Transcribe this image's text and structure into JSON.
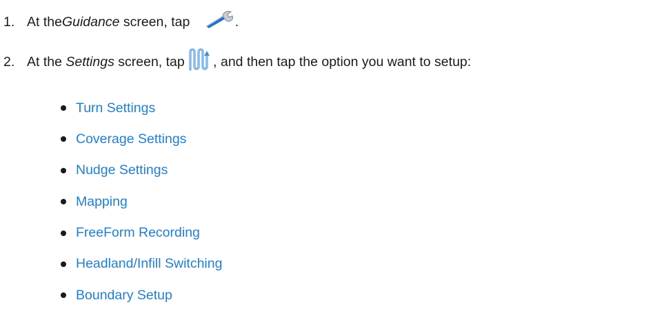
{
  "steps": [
    {
      "number": "1.",
      "text_before": "At the ",
      "emphasis": "Guidance",
      "text_middle": " screen, tap ",
      "icon": "wrench-icon",
      "text_after": "."
    },
    {
      "number": "2.",
      "text_before": "At the ",
      "emphasis": "Settings",
      "text_middle": " screen, tap ",
      "icon": "guidance-pattern-icon",
      "text_after": ", and then tap the option you want to setup:"
    }
  ],
  "options": [
    {
      "label": "Turn Settings"
    },
    {
      "label": "Coverage Settings"
    },
    {
      "label": "Nudge Settings"
    },
    {
      "label": "Mapping"
    },
    {
      "label": "FreeForm Recording"
    },
    {
      "label": "Headland/Infill Switching"
    },
    {
      "label": "Boundary Setup"
    }
  ],
  "colors": {
    "link": "#1f7fd1",
    "text": "#1a1a1a",
    "wrench_blue": "#2a6fbf",
    "pattern_blue": "#3f8fdc"
  }
}
